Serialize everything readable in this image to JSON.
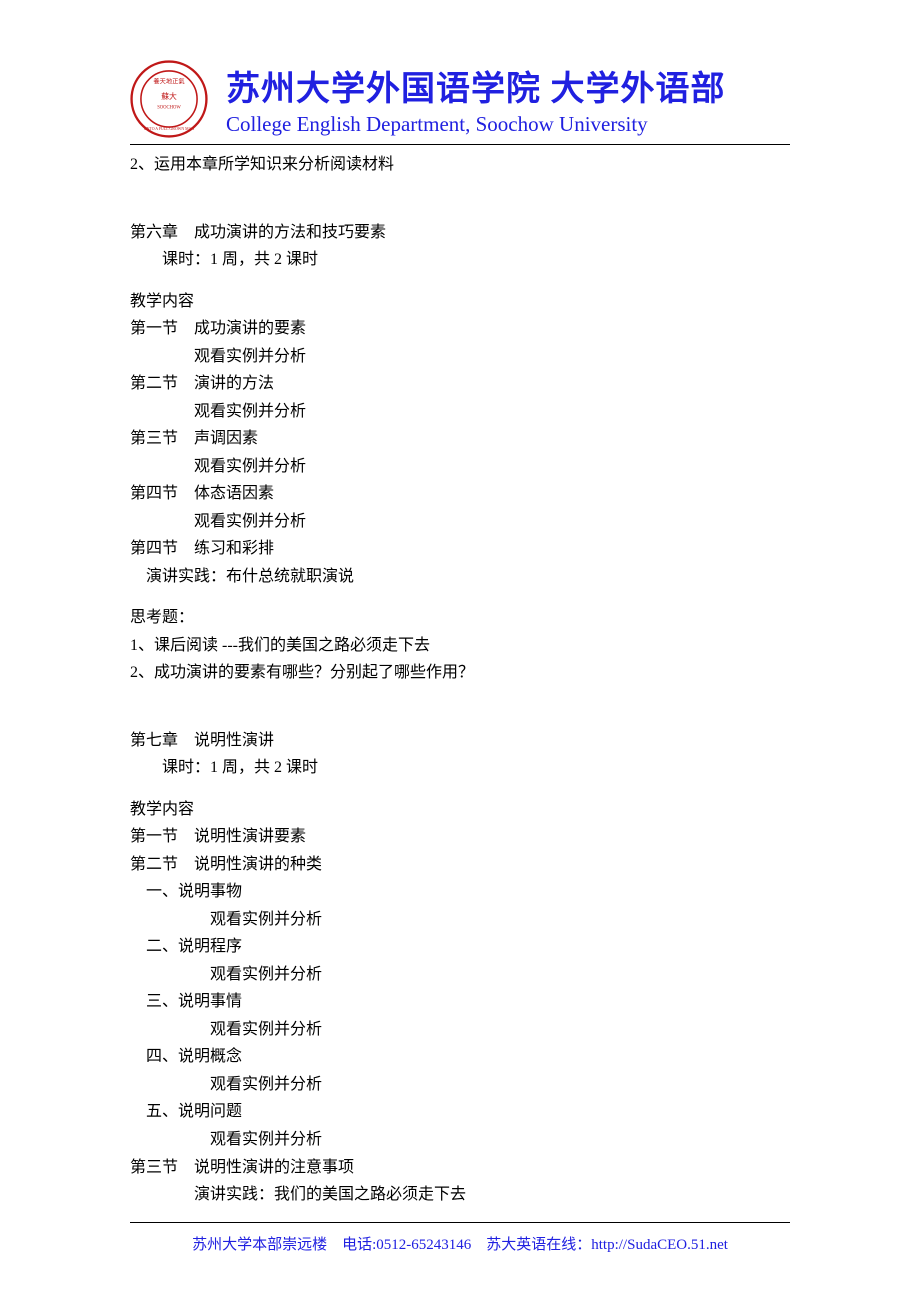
{
  "header": {
    "title_cn": "苏州大学外国语学院 大学外语部",
    "title_en": "College English Department, Soochow University"
  },
  "body": {
    "top_line": "2、运用本章所学知识来分析阅读材料",
    "ch6": {
      "title": "第六章　成功演讲的方法和技巧要素",
      "hours": "课时：1 周，共 2 课时",
      "content_label": "教学内容",
      "s1": "第一节　成功演讲的要素",
      "s1b": "观看实例并分析",
      "s2": "第二节　演讲的方法",
      "s2b": "观看实例并分析",
      "s3": "第三节　声调因素",
      "s3b": "观看实例并分析",
      "s4": "第四节　体态语因素",
      "s4b": "观看实例并分析",
      "s5": "第四节　练习和彩排",
      "practice": "演讲实践：布什总统就职演说",
      "q_label": "思考题：",
      "q1": "1、课后阅读 ---我们的美国之路必须走下去",
      "q2": "2、成功演讲的要素有哪些？分别起了哪些作用？"
    },
    "ch7": {
      "title": "第七章　说明性演讲",
      "hours": "课时：1 周，共 2 课时",
      "content_label": "教学内容",
      "s1": "第一节　说明性演讲要素",
      "s2": "第二节　说明性演讲的种类",
      "i1": "一、说明事物",
      "i1b": "观看实例并分析",
      "i2": "二、说明程序",
      "i2b": "观看实例并分析",
      "i3": "三、说明事情",
      "i3b": "观看实例并分析",
      "i4": "四、说明概念",
      "i4b": "观看实例并分析",
      "i5": "五、说明问题",
      "i5b": "观看实例并分析",
      "s3": "第三节　说明性演讲的注意事项",
      "practice": "演讲实践：我们的美国之路必须走下去"
    }
  },
  "footer": {
    "addr": "苏州大学本部崇远楼",
    "tel_label": "电话:",
    "tel": "0512-65243146",
    "site_label": "苏大英语在线：",
    "site_url": "http://SudaCEO.51.net"
  }
}
